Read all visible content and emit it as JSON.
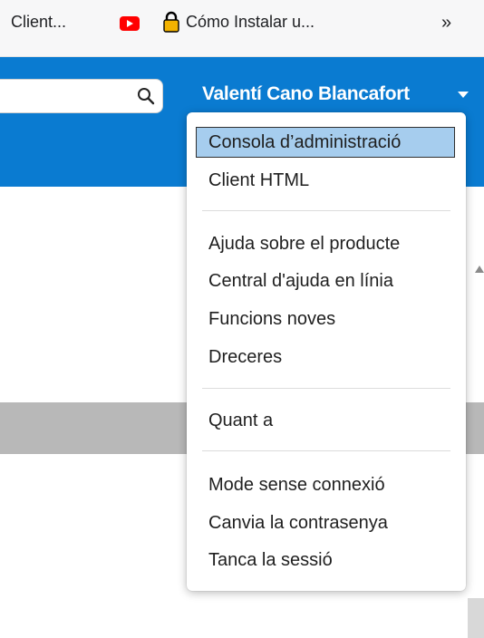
{
  "bookmarks": {
    "item1_label": "Client...",
    "item2_label": "Cómo Instalar u...",
    "more_label": "»"
  },
  "header": {
    "user_name": "Valentí Cano Blancafort"
  },
  "menu": {
    "items": [
      {
        "label": "Consola d’administració",
        "highlighted": true
      },
      {
        "label": "Client HTML"
      },
      {
        "label": "Ajuda sobre el producte"
      },
      {
        "label": "Central d'ajuda en línia"
      },
      {
        "label": "Funcions noves"
      },
      {
        "label": "Dreceres"
      },
      {
        "label": "Quant a"
      },
      {
        "label": "Mode sense connexió"
      },
      {
        "label": "Canvia la contrasenya"
      },
      {
        "label": "Tanca la sessió"
      }
    ]
  },
  "colors": {
    "header_bg": "#0a7bd1",
    "highlight_bg": "#a6cdee",
    "youtube_red": "#ff0000",
    "lock_yellow": "#f2b200"
  },
  "icons": [
    "youtube-icon",
    "lock-icon",
    "search-icon",
    "chevron-down-icon",
    "double-chevron-icon"
  ]
}
